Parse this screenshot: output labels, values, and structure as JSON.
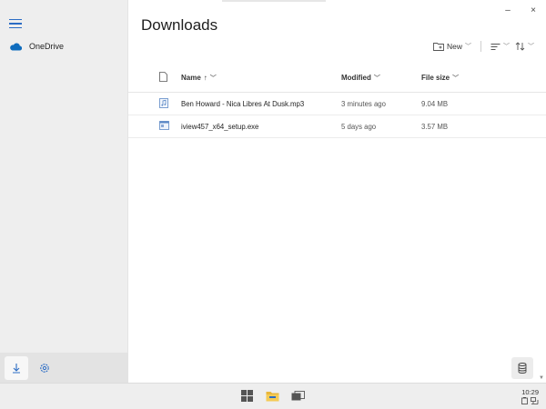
{
  "sidebar": {
    "nav": [
      {
        "label": "OneDrive",
        "icon": "cloud-icon"
      }
    ],
    "bottom": [
      {
        "icon": "download-arrow-icon",
        "active": true
      },
      {
        "icon": "gear-icon",
        "active": false
      }
    ]
  },
  "window": {
    "minimize": "–",
    "close": "×"
  },
  "main": {
    "title": "Downloads",
    "toolbar": {
      "new_label": "New"
    },
    "columns": {
      "name": "Name",
      "name_sort": "↑",
      "modified": "Modified",
      "size": "File size"
    },
    "files": [
      {
        "name": "Ben Howard - Nica Libres At Dusk.mp3",
        "modified": "3 minutes ago",
        "size": "9.04 MB",
        "icon": "audio-file-icon"
      },
      {
        "name": "iview457_x64_setup.exe",
        "modified": "5 days ago",
        "size": "3.57 MB",
        "icon": "exe-file-icon"
      }
    ]
  },
  "taskbar": {
    "time": "10:29"
  },
  "colors": {
    "accent": "#2b6cc4",
    "onedrive": "#0f6cbd",
    "folder": "#e9b63a"
  }
}
